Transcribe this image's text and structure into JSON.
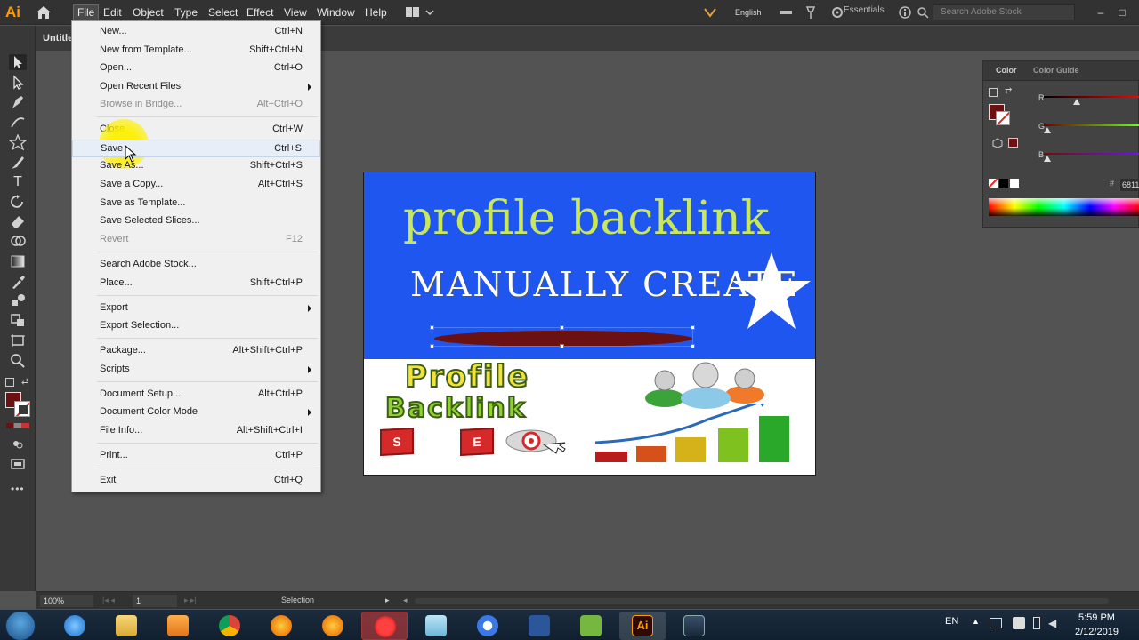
{
  "app": {
    "logo": "Ai"
  },
  "menubar": {
    "items": [
      "File",
      "Edit",
      "Object",
      "Type",
      "Select",
      "Effect",
      "View",
      "Window",
      "Help"
    ],
    "language": "English",
    "workspace": "Essentials",
    "search_placeholder": "Search Adobe Stock"
  },
  "document": {
    "tab_title": "Untitle"
  },
  "file_menu": {
    "items": [
      {
        "label": "New...",
        "shortcut": "Ctrl+N"
      },
      {
        "label": "New from Template...",
        "shortcut": "Shift+Ctrl+N"
      },
      {
        "label": "Open...",
        "shortcut": "Ctrl+O"
      },
      {
        "label": "Open Recent Files",
        "shortcut": ""
      },
      {
        "label": "Browse in Bridge...",
        "shortcut": "Alt+Ctrl+O"
      },
      {
        "label": "Close",
        "shortcut": "Ctrl+W"
      },
      {
        "label": "Save",
        "shortcut": "Ctrl+S"
      },
      {
        "label": "Save As...",
        "shortcut": "Shift+Ctrl+S"
      },
      {
        "label": "Save a Copy...",
        "shortcut": "Alt+Ctrl+S"
      },
      {
        "label": "Save as Template...",
        "shortcut": ""
      },
      {
        "label": "Save Selected Slices...",
        "shortcut": ""
      },
      {
        "label": "Revert",
        "shortcut": "F12"
      },
      {
        "label": "Search Adobe Stock...",
        "shortcut": ""
      },
      {
        "label": "Place...",
        "shortcut": "Shift+Ctrl+P"
      },
      {
        "label": "Export",
        "shortcut": ""
      },
      {
        "label": "Export Selection...",
        "shortcut": ""
      },
      {
        "label": "Package...",
        "shortcut": "Alt+Shift+Ctrl+P"
      },
      {
        "label": "Scripts",
        "shortcut": ""
      },
      {
        "label": "Document Setup...",
        "shortcut": "Alt+Ctrl+P"
      },
      {
        "label": "Document Color Mode",
        "shortcut": ""
      },
      {
        "label": "File Info...",
        "shortcut": "Alt+Shift+Ctrl+I"
      },
      {
        "label": "Print...",
        "shortcut": "Ctrl+P"
      },
      {
        "label": "Exit",
        "shortcut": "Ctrl+Q"
      }
    ]
  },
  "artboard": {
    "title": "profile backlink",
    "subtitle": "MANUALLY CREATE",
    "wordart_1": "Profile",
    "wordart_2": "Backlink",
    "seo_letters": [
      "S",
      "E"
    ]
  },
  "color_panel": {
    "tabs": [
      "Color",
      "Color Guide"
    ],
    "channels": [
      "R",
      "G",
      "B"
    ],
    "hex_label": "#",
    "hex_value": "6811",
    "fill_color": "#6b1111"
  },
  "statusbar": {
    "zoom": "100%",
    "page": "1",
    "tool": "Selection"
  },
  "taskbar": {
    "language": "EN",
    "time": "5:59 PM",
    "date": "2/12/2019"
  }
}
